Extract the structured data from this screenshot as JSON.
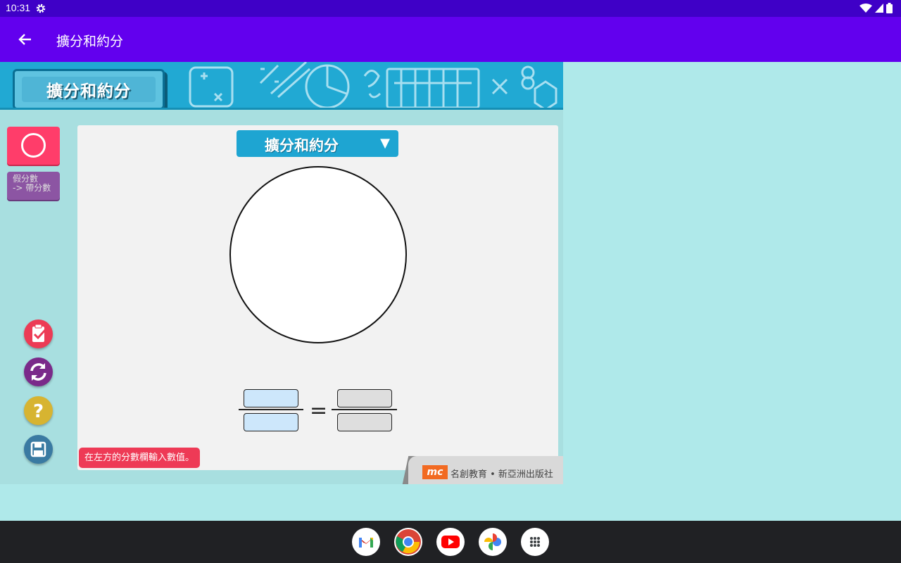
{
  "status_bar": {
    "time": "10:31",
    "icons": [
      "settings-gear-icon",
      "wifi-icon",
      "signal-icon",
      "battery-icon"
    ]
  },
  "app_bar": {
    "title": "擴分和約分",
    "back_icon": "arrow-left-icon"
  },
  "content": {
    "banner_title": "擴分和約分",
    "tools": {
      "circle_icon": "circle-shape-icon",
      "convert_line1": "假分數",
      "convert_line2": "-> 帶分數"
    },
    "side_buttons": [
      "check-clipboard-icon",
      "refresh-icon",
      "help-icon",
      "save-icon"
    ],
    "mode_select": {
      "value": "擴分和約分",
      "arrow": "▼"
    },
    "equals": "=",
    "hint": "在左方的分數欄輸入數值。",
    "brand": {
      "logo": "mc",
      "text": "名創教育 • 新亞洲出版社"
    }
  },
  "colors": {
    "status_bar": "#3f00c7",
    "app_bar": "#6200ee",
    "background": "#afe9ea",
    "banner": "#21a9d3",
    "circle_tool": "#ff3d6a",
    "convert_button": "#8c55a3",
    "hint": "#ee3a56"
  },
  "dock": [
    "gmail-icon",
    "chrome-icon",
    "youtube-icon",
    "photos-icon",
    "app-launcher-icon"
  ]
}
